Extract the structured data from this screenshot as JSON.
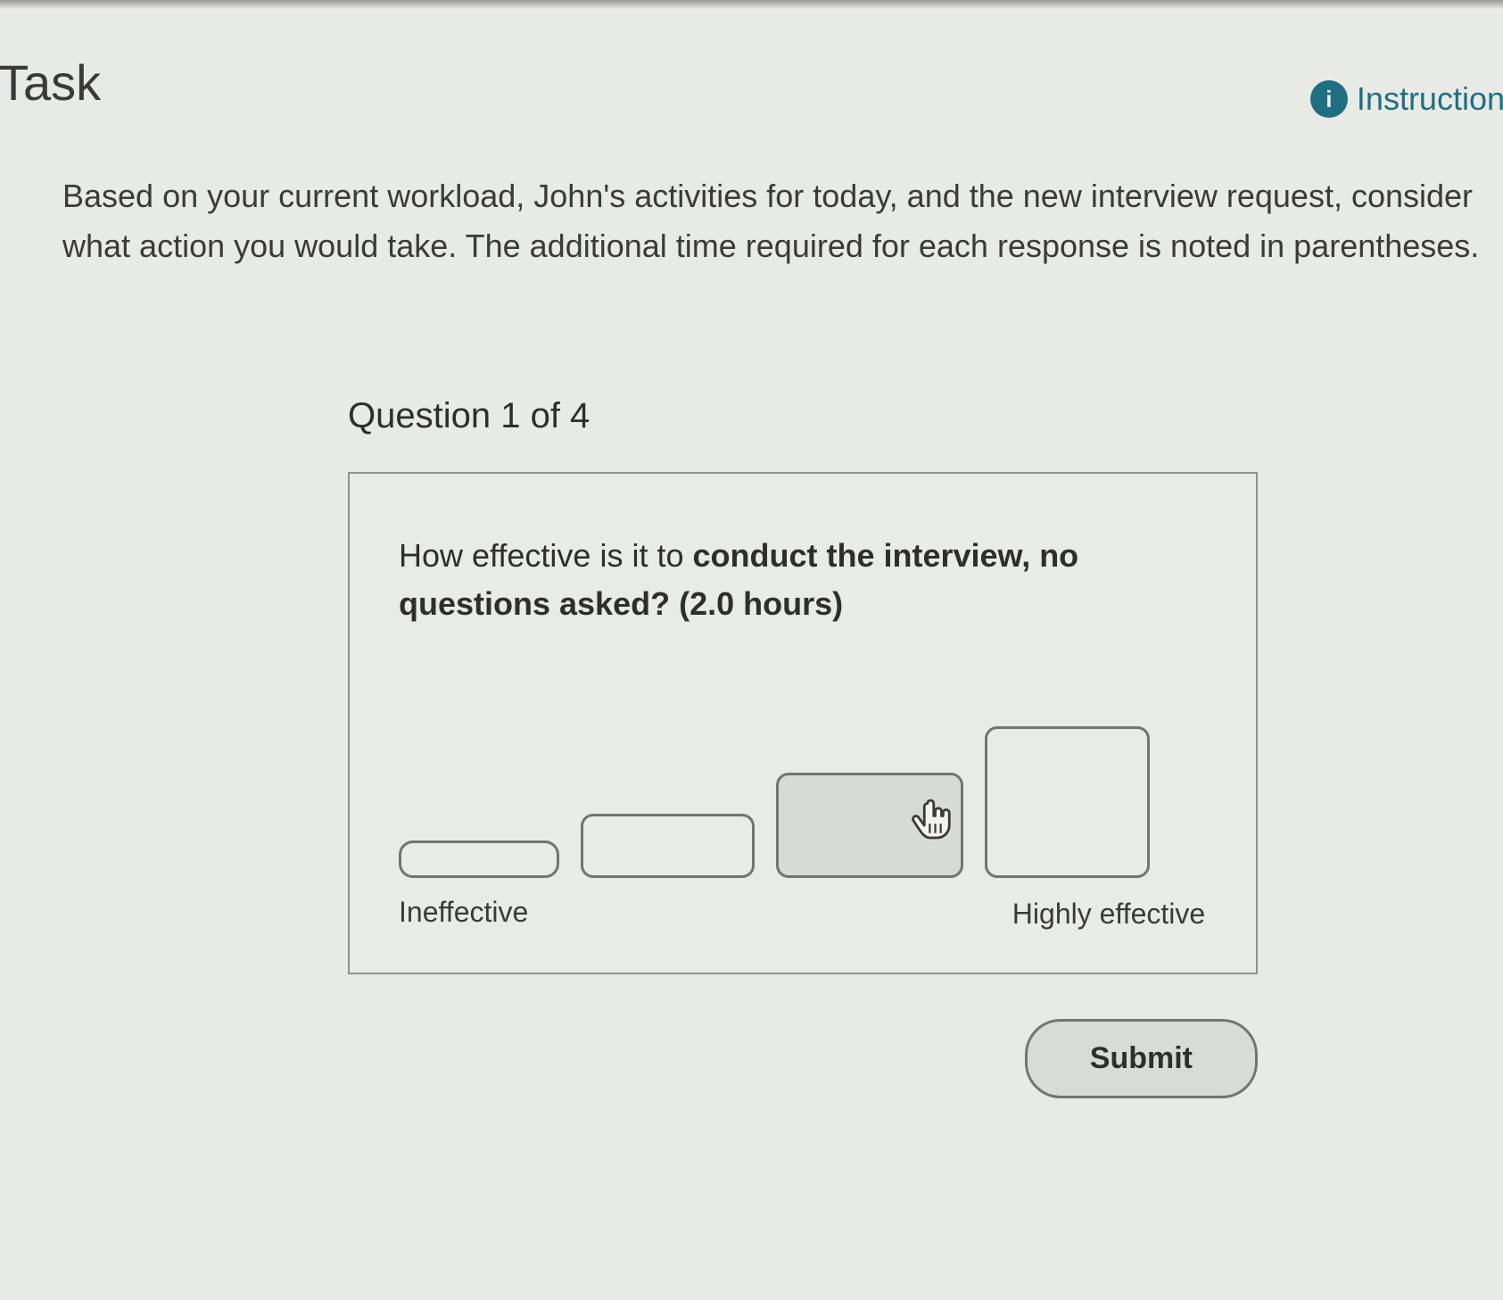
{
  "header": {
    "title": "Task",
    "instructions_label": "Instruction"
  },
  "intro_text": "Based on your current workload, John's activities for today, and the new interview request, consider what action you would take. The additional time required for each response is noted in parentheses.",
  "question": {
    "counter": "Question 1 of 4",
    "lead": "How effective is it to ",
    "bold": "conduct the interview, no questions asked?",
    "paren": " (2.0 hours)",
    "scale_low_label": "Ineffective",
    "scale_high_label": "Highly effective"
  },
  "buttons": {
    "submit": "Submit"
  }
}
